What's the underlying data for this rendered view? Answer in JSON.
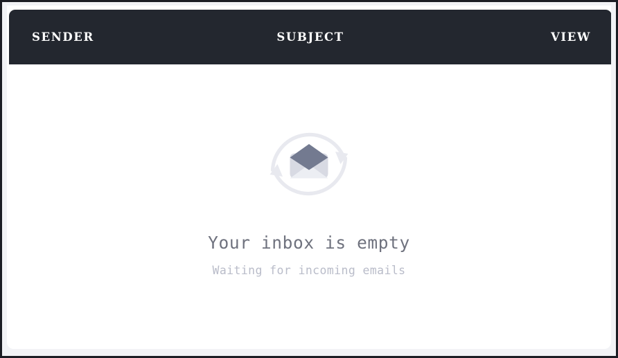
{
  "window": {
    "frame_color": "#1b1d24",
    "backdrop_color": "#f2f3f6",
    "card_background": "#ffffff"
  },
  "table_header": {
    "background_color": "#23272f",
    "text_color": "#ffffff",
    "columns": [
      {
        "key": "sender",
        "label": "SENDER"
      },
      {
        "key": "subject",
        "label": "SUBJECT"
      },
      {
        "key": "view",
        "label": "VIEW"
      }
    ]
  },
  "empty_state": {
    "icon_name": "envelope-sync-icon",
    "icon_colors": {
      "arc": "#e8e9ef",
      "envelope_body": "#d8dae3",
      "envelope_flap": "#737a90",
      "envelope_fold": "#eceef3"
    },
    "title": "Your inbox is empty",
    "title_color": "#6f727e",
    "subtitle": "Waiting for incoming emails",
    "subtitle_color": "#b9bcc9"
  },
  "rows": []
}
